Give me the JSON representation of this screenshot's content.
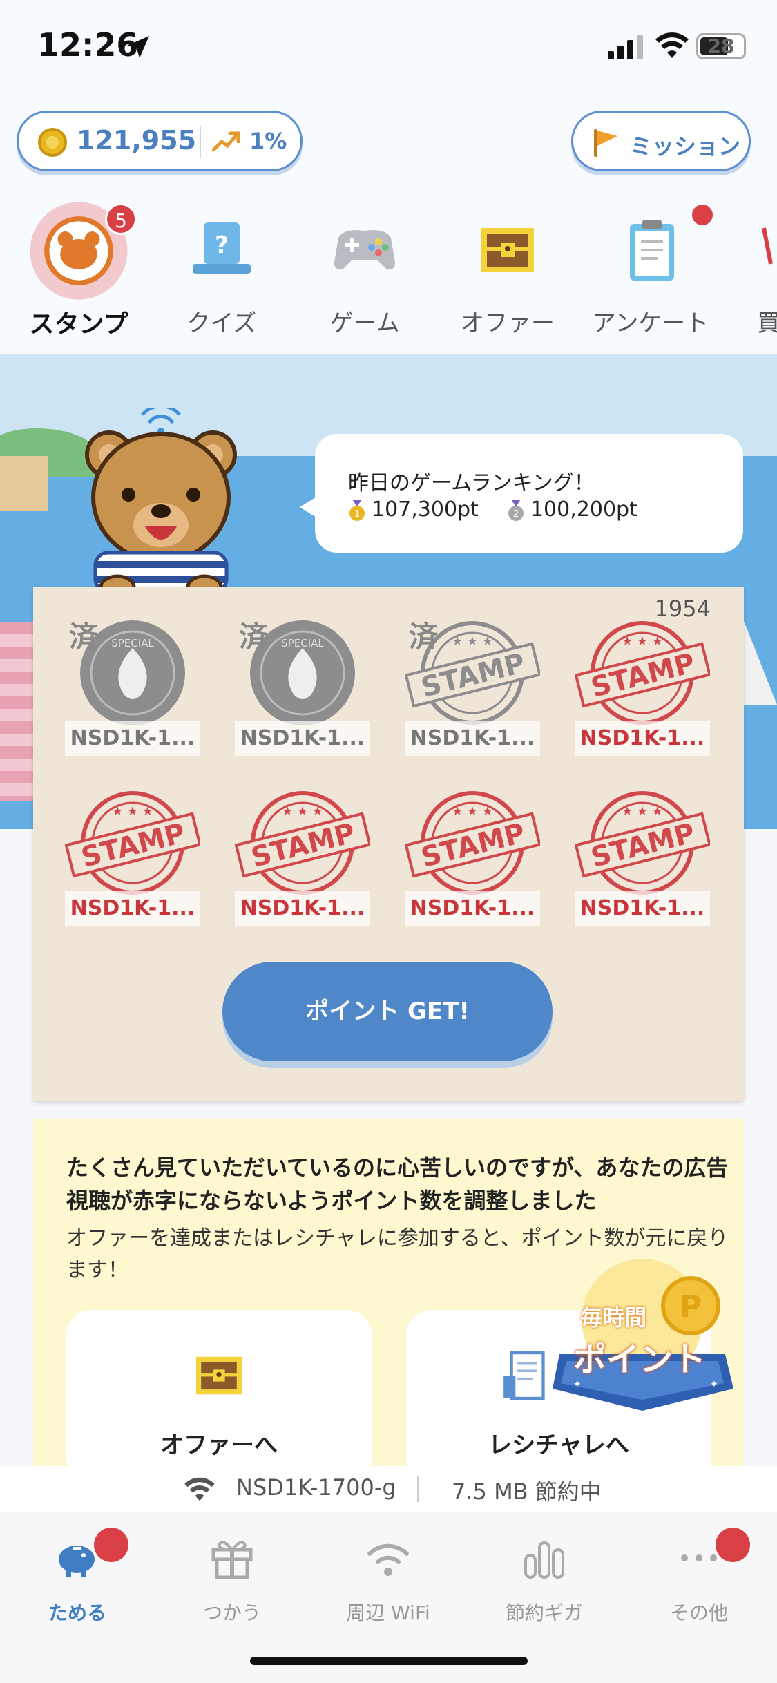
{
  "status_bar": {
    "time": "12:26",
    "battery": "28"
  },
  "header": {
    "points": "121,955",
    "rate": "1%",
    "mission_label": "ミッション"
  },
  "categories": [
    {
      "label": "スタンプ",
      "badge": "5",
      "active": true
    },
    {
      "label": "クイズ"
    },
    {
      "label": "ゲーム"
    },
    {
      "label": "オファー"
    },
    {
      "label": "アンケート"
    },
    {
      "label": "買"
    }
  ],
  "ranking": {
    "title": "昨日のゲームランキング！",
    "first": "107,300pt",
    "second": "100,200pt"
  },
  "stamp_card": {
    "count": "1954",
    "stamps": [
      {
        "label": "NSD1K-1...",
        "done_mark": "済",
        "status": "used",
        "kind": "special"
      },
      {
        "label": "NSD1K-1...",
        "done_mark": "済",
        "status": "used",
        "kind": "special"
      },
      {
        "label": "NSD1K-1...",
        "done_mark": "済",
        "status": "used",
        "kind": "stamp"
      },
      {
        "label": "NSD1K-1...",
        "status": "new",
        "kind": "stamp"
      },
      {
        "label": "NSD1K-1...",
        "status": "new",
        "kind": "stamp"
      },
      {
        "label": "NSD1K-1...",
        "status": "new",
        "kind": "stamp"
      },
      {
        "label": "NSD1K-1...",
        "status": "new",
        "kind": "stamp"
      },
      {
        "label": "NSD1K-1...",
        "status": "new",
        "kind": "stamp"
      }
    ],
    "stamp_text": "STAMP",
    "special_text": "SPECIAL",
    "button_label": "ポイント GET!"
  },
  "notice": {
    "title": "たくさん見ていただいているのに心苦しいのですが、あなたの広告視聴が赤字にならないようポイント数を調整しました",
    "subtitle": "オファーを達成またはレシチャレに参加すると、ポイント数が元に戻ります！",
    "offer_button": "オファーへ",
    "receipt_button": "レシチャレへ",
    "hourly_badge_line1": "毎時間",
    "hourly_badge_line2": "ポイント"
  },
  "wifi_bar": {
    "ssid": "NSD1K-1700-g",
    "saving": "7.5 MB 節約中"
  },
  "tabs": [
    {
      "label": "ためる",
      "active": true
    },
    {
      "label": "つかう"
    },
    {
      "label": "周辺 WiFi"
    },
    {
      "label": "節約ギガ"
    },
    {
      "label": "その他"
    }
  ],
  "colors": {
    "accent": "#4f87c9",
    "badge": "#d94046",
    "stamp_red": "#c8353b"
  }
}
